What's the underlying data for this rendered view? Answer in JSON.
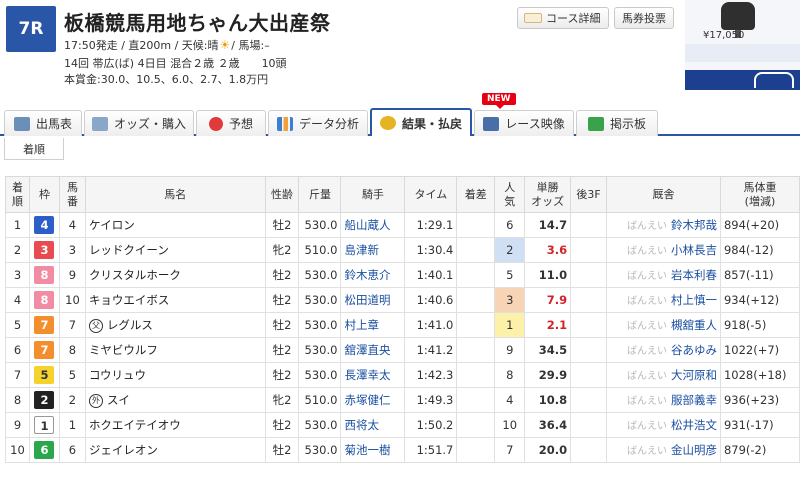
{
  "race": {
    "number": "7R",
    "title": "板橋競馬用地ちゃん大出産祭",
    "info": "17:50発走 / 直200m / 天候:晴",
    "sun": "☀",
    "info_track": "/ 馬場:–",
    "details": "14回 帯広(ば) 4日目 混合２歳 ２歳　　10頭",
    "prize": "本賞金:30.0、10.5、6.0、2.7、1.8万円"
  },
  "header_buttons": {
    "course": "コース詳細",
    "vote": "馬券投票"
  },
  "ad": {
    "price": "¥17,050"
  },
  "tabs": [
    {
      "label": "出馬表"
    },
    {
      "label": "オッズ・購入"
    },
    {
      "label": "予想"
    },
    {
      "label": "データ分析"
    },
    {
      "label": "結果・払戻"
    },
    {
      "label": "レース映像"
    },
    {
      "label": "掲示板"
    }
  ],
  "new_badge": "NEW",
  "subtab": "着順",
  "columns": [
    "着\n順",
    "枠",
    "馬\n番",
    "馬名",
    "性齢",
    "斤量",
    "騎手",
    "タイム",
    "着差",
    "人\n気",
    "単勝\nオッズ",
    "後3F",
    "厩舎",
    "馬体重\n(増減)"
  ],
  "rows": [
    {
      "rank": "1",
      "waku": "4",
      "umaban": "4",
      "horse": "ケイロン",
      "marker": "",
      "sexage": "牡2",
      "weight": "530.0",
      "jockey": "船山蔵人",
      "time": "1:29.1",
      "margin": "",
      "pop": "6",
      "odds": "14.7",
      "last3f": "",
      "stable_loc": "ばんえい",
      "trainer": "鈴木邦哉",
      "body": "894(+20)"
    },
    {
      "rank": "2",
      "waku": "3",
      "umaban": "3",
      "horse": "レッドクイーン",
      "marker": "",
      "sexage": "牝2",
      "weight": "510.0",
      "jockey": "島津新",
      "time": "1:30.4",
      "margin": "",
      "pop": "2",
      "odds": "3.6",
      "last3f": "",
      "stable_loc": "ばんえい",
      "trainer": "小林長吉",
      "body": "984(-12)"
    },
    {
      "rank": "3",
      "waku": "8",
      "umaban": "9",
      "horse": "クリスタルホーク",
      "marker": "",
      "sexage": "牡2",
      "weight": "530.0",
      "jockey": "鈴木恵介",
      "time": "1:40.1",
      "margin": "",
      "pop": "5",
      "odds": "11.0",
      "last3f": "",
      "stable_loc": "ばんえい",
      "trainer": "岩本利春",
      "body": "857(-11)"
    },
    {
      "rank": "4",
      "waku": "8",
      "umaban": "10",
      "horse": "キョウエイボス",
      "marker": "",
      "sexage": "牡2",
      "weight": "530.0",
      "jockey": "松田道明",
      "time": "1:40.6",
      "margin": "",
      "pop": "3",
      "odds": "7.9",
      "last3f": "",
      "stable_loc": "ばんえい",
      "trainer": "村上慎一",
      "body": "934(+12)"
    },
    {
      "rank": "5",
      "waku": "7",
      "umaban": "7",
      "horse": "レグルス",
      "marker": "父",
      "sexage": "牡2",
      "weight": "530.0",
      "jockey": "村上章",
      "time": "1:41.0",
      "margin": "",
      "pop": "1",
      "odds": "2.1",
      "last3f": "",
      "stable_loc": "ばんえい",
      "trainer": "槻舘重人",
      "body": "918(-5)"
    },
    {
      "rank": "6",
      "waku": "7",
      "umaban": "8",
      "horse": "ミヤビウルフ",
      "marker": "",
      "sexage": "牡2",
      "weight": "530.0",
      "jockey": "舘澤直央",
      "time": "1:41.2",
      "margin": "",
      "pop": "9",
      "odds": "34.5",
      "last3f": "",
      "stable_loc": "ばんえい",
      "trainer": "谷あゆみ",
      "body": "1022(+7)"
    },
    {
      "rank": "7",
      "waku": "5",
      "umaban": "5",
      "horse": "コウリュウ",
      "marker": "",
      "sexage": "牡2",
      "weight": "530.0",
      "jockey": "長澤幸太",
      "time": "1:42.3",
      "margin": "",
      "pop": "8",
      "odds": "29.9",
      "last3f": "",
      "stable_loc": "ばんえい",
      "trainer": "大河原和",
      "body": "1028(+18)"
    },
    {
      "rank": "8",
      "waku": "2",
      "umaban": "2",
      "horse": "スイ",
      "marker": "外",
      "sexage": "牝2",
      "weight": "510.0",
      "jockey": "赤塚健仁",
      "time": "1:49.3",
      "margin": "",
      "pop": "4",
      "odds": "10.8",
      "last3f": "",
      "stable_loc": "ばんえい",
      "trainer": "服部義幸",
      "body": "936(+23)"
    },
    {
      "rank": "9",
      "waku": "1",
      "umaban": "1",
      "horse": "ホクエイテイオウ",
      "marker": "",
      "sexage": "牡2",
      "weight": "530.0",
      "jockey": "西将太",
      "time": "1:50.2",
      "margin": "",
      "pop": "10",
      "odds": "36.4",
      "last3f": "",
      "stable_loc": "ばんえい",
      "trainer": "松井浩文",
      "body": "931(-17)"
    },
    {
      "rank": "10",
      "waku": "6",
      "umaban": "6",
      "horse": "ジェイレオン",
      "marker": "",
      "sexage": "牡2",
      "weight": "530.0",
      "jockey": "菊池一樹",
      "time": "1:51.7",
      "margin": "",
      "pop": "7",
      "odds": "20.0",
      "last3f": "",
      "stable_loc": "ばんえい",
      "trainer": "金山明彦",
      "body": "879(-2)"
    }
  ],
  "colors": {
    "accent": "#2a56a8",
    "waku": {
      "1": "#ffffff",
      "2": "#222222",
      "3": "#e84c50",
      "4": "#2e5fc9",
      "5": "#f5d32c",
      "6": "#2ca64b",
      "7": "#f48e2c",
      "8": "#f28ba4"
    },
    "odds_highlight": "#d2232a"
  },
  "icons": [
    "sun-icon",
    "course-map-icon",
    "shutuba-icon",
    "odds-icon",
    "yoso-target-icon",
    "data-chart-icon",
    "result-coins-icon",
    "video-icon",
    "board-icon"
  ]
}
